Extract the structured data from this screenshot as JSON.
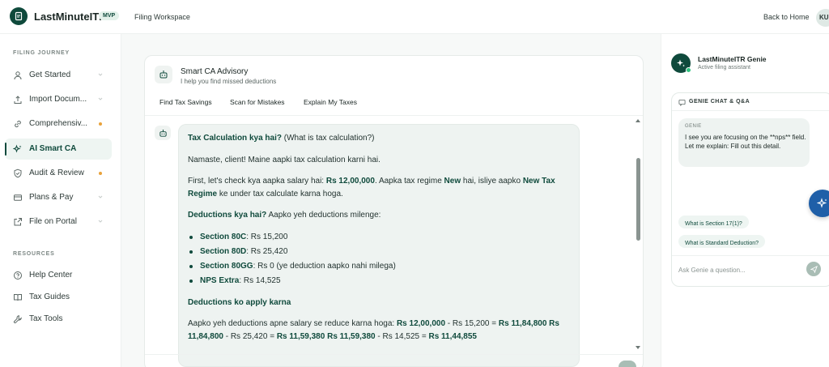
{
  "header": {
    "brand": "LastMinuteITR",
    "badge": "MVP",
    "workspace": "Filing Workspace",
    "back_home": "Back to Home",
    "avatar_initials": "KU"
  },
  "sidebar": {
    "journey_label": "FILING JOURNEY",
    "journey_items": [
      {
        "label": "Get Started",
        "icon": "user-icon",
        "state": "chevron"
      },
      {
        "label": "Import Docum...",
        "icon": "upload-icon",
        "state": "chevron"
      },
      {
        "label": "Comprehensiv...",
        "icon": "link-icon",
        "state": "dot"
      },
      {
        "label": "AI Smart CA",
        "icon": "sparkle-icon",
        "state": "active"
      },
      {
        "label": "Audit & Review",
        "icon": "shield-icon",
        "state": "dot"
      },
      {
        "label": "Plans & Pay",
        "icon": "card-icon",
        "state": "chevron"
      },
      {
        "label": "File on Portal",
        "icon": "external-link-icon",
        "state": "chevron"
      }
    ],
    "resources_label": "RESOURCES",
    "resource_items": [
      {
        "label": "Help Center",
        "icon": "help-icon"
      },
      {
        "label": "Tax Guides",
        "icon": "book-icon"
      },
      {
        "label": "Tax Tools",
        "icon": "wrench-icon"
      }
    ]
  },
  "advisory": {
    "title": "Smart CA Advisory",
    "subtitle": "I help you find missed deductions",
    "actions": [
      "Find Tax Savings",
      "Scan for Mistakes",
      "Explain My Taxes"
    ],
    "message": {
      "q_bold": "Tax Calculation kya hai?",
      "q_rest": " (What is tax calculation?)",
      "greeting": "Namaste, client! Maine aapki tax calculation karni hai.",
      "p2_a": "First, let's check kya aapka salary hai: ",
      "p2_salary": "Rs 12,00,000",
      "p2_b": ". Aapka tax regime ",
      "p2_new": "New",
      "p2_c": " hai, isliye aapko ",
      "p2_regime1": "New Tax",
      "p2_regime2": "Regime",
      "p2_d": " ke under tax calculate karna hoga.",
      "ded_bold": "Deductions kya hai?",
      "ded_rest": " Aapko yeh deductions milenge:",
      "deductions": [
        {
          "name": "Section 80C",
          "value": ": Rs 15,200"
        },
        {
          "name": "Section 80D",
          "value": ": Rs 25,420"
        },
        {
          "name": "Section 80GG",
          "value": ": Rs 0 (ye deduction aapko nahi milega)"
        },
        {
          "name": "NPS Extra",
          "value": ": Rs 14,525"
        }
      ],
      "apply_heading": "Deductions ko apply karna",
      "calc_a": "Aapko yeh deductions apne salary se reduce karna hoga: ",
      "calc_v1": "Rs 12,00,000",
      "calc_b": " - Rs 15,200 = ",
      "calc_v2": "Rs 11,84,800",
      "calc_v3": "Rs",
      "calc_v4": "11,84,800",
      "calc_c": " - Rs 25,420 = ",
      "calc_v5": "Rs 11,59,380",
      "calc_v6": "Rs 11,59,380",
      "calc_d": " - Rs 14,525 = ",
      "calc_v7": "Rs 11,44,855"
    }
  },
  "genie": {
    "title": "LastMinuteITR Genie",
    "subtitle": "Active filing assistant",
    "chat_header": "GENIE CHAT & Q&A",
    "bubble_label": "GENIE",
    "bubble_text": "I see you are focusing on the **nps** field. Let me explain: Fill out this detail.",
    "suggestions": [
      "What is Section 17(1)?",
      "What is Standard Deduction?"
    ],
    "input_placeholder": "Ask Genie a question..."
  },
  "colors": {
    "brand_dark": "#0f4a3c",
    "accent_orange": "#e9a23b",
    "fab_blue": "#1f5fa8",
    "online_green": "#2ec27e"
  }
}
